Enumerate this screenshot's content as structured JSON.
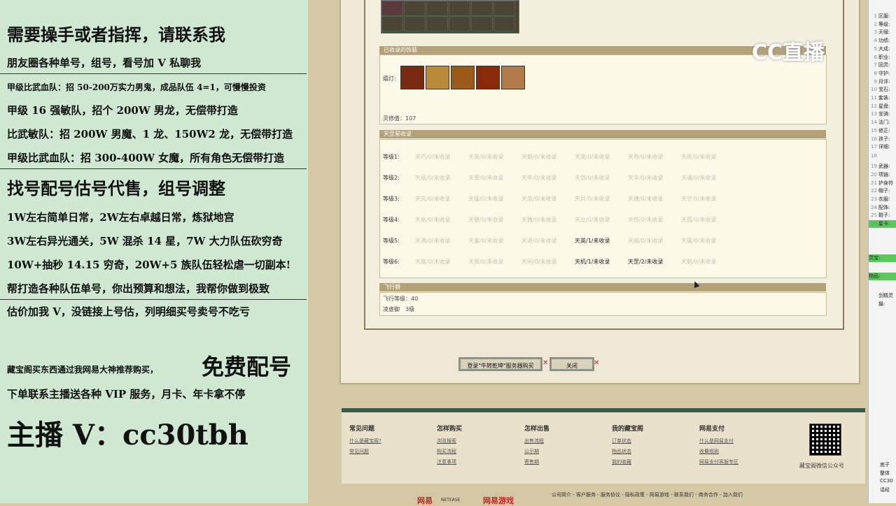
{
  "left": {
    "lines": [
      "需要操手或者指挥，请联系我",
      "朋友圈各种单号，组号，看号加 V 私聊我",
      "甲级比武血队：招 50-200万实力男鬼，成品队伍 4=1，可慢慢投资",
      "甲级 16 强敏队，招个 200W 男龙，无偿带打造",
      "比武敏队：招 200W 男魔、1 龙、150W2 龙，无偿带打造",
      "甲级比武血队：招 300-400W 女魔，所有角色无偿带打造",
      "找号配号估号代售，组号调整",
      "1W左右简单日常，2W左右卓越日常，炼狱地宫",
      "3W左右异光通关，5W 混杀 14 星，7W 大力队伍砍穷奇",
      "10W+抽秒 14.15 穷奇，20W+5 族队伍轻松虐一切副本!",
      "帮打造各种队伍单号，你出预算和想法，我帮你做到极致",
      "估价加我 V，没链接上号估，列明细买号卖号不吃亏",
      "藏宝阁买东西通过我网易大神推荐购买，",
      "免费配号",
      "下单联系主播送各种 VIP 服务，月卡、年卡拿不停",
      "主播 V：cc30tbh"
    ]
  },
  "game": {
    "collected_header": "已收录的饰装",
    "equip_label": "嬉灯:",
    "lingxiu": "灵修值：107",
    "tiangang_header": "天罡星收录",
    "levels": [
      "等级1:",
      "等级2:",
      "等级3:",
      "等级4:",
      "等级5:",
      "等级6:"
    ],
    "grid": [
      [
        "天巧/0/未收录",
        "天英/0/未收录",
        "天魁/0/未收录",
        "天哭/0/未收录",
        "天寿/0/未收录",
        "天败/0/未收录"
      ],
      [
        "天损/0/未收录",
        "天罪/0/未收录",
        "天牢/0/未收录",
        "天剑/0/未收录",
        "天华/0/未收录",
        "天速/0/未收录"
      ],
      [
        "天究/0/未收录",
        "天猛/0/未收录",
        "天杀/0/未收录",
        "天异/0/未收录",
        "天捷/0/未收录",
        "天空/0/未收录"
      ],
      [
        "天佑/0/未收录",
        "天暴/0/未收录",
        "天微/0/未收录",
        "天立/0/未收录",
        "天伤/0/未收录",
        "天孤/0/未收录"
      ],
      [
        "天满/0/未收录",
        "天富/0/未收录",
        "天退/0/未收录",
        "天英/1/未收录",
        "天威/0/未收录",
        "天猛/0/未收录"
      ],
      [
        "天雄/0/未收录",
        "天贵/0/未收录",
        "天闲/0/未收录",
        "天机/1/未收录",
        "天罡/2/未收录",
        "天魁/0/未收录"
      ]
    ],
    "grid_active": [
      [
        4,
        3
      ],
      [
        5,
        3
      ],
      [
        5,
        4
      ]
    ],
    "flight_header": "飞行器",
    "flight_level": "飞行等级：40",
    "flight_speed": "凌虚御　3级",
    "login_button": "登录\"牛转乾坤\"服务器购买",
    "close_button": "关闭",
    "watermark": "CC直播"
  },
  "footer": {
    "cols": [
      {
        "title": "常见问题",
        "links": [
          "什么是藏宝阁?",
          "常见问题"
        ]
      },
      {
        "title": "怎样购买",
        "links": [
          "浏览搜索",
          "购买流程",
          "注意事项"
        ]
      },
      {
        "title": "怎样出售",
        "links": [
          "出售流程",
          "公示期",
          "寄售期"
        ]
      },
      {
        "title": "我的藏宝阁",
        "links": [
          "订单状态",
          "物品状态",
          "我的收藏"
        ]
      },
      {
        "title": "网易支付",
        "links": [
          "什么是网易支付",
          "收費规则",
          "网易支付客服专区"
        ]
      }
    ],
    "qr_caption": "藏宝阁微信公众号",
    "bottom_links": "公司简介 - 客户服务 - 服务协议 - 隐私政策 - 网易游戏 - 联系我们 - 商务合作 - 加入我们",
    "logo_netease": "网易",
    "logo_netease_en": "NETEASE",
    "logo_games": "网易游戏"
  },
  "right_panel": {
    "rows": [
      {
        "n": "1",
        "t": "区服:"
      },
      {
        "n": "2",
        "t": "等级:"
      },
      {
        "n": "3",
        "t": "天赋:"
      },
      {
        "n": "4",
        "t": "功绩:"
      },
      {
        "n": "5",
        "t": "大成:"
      },
      {
        "n": "6",
        "t": "职业:"
      },
      {
        "n": "7",
        "t": "回灵:"
      },
      {
        "n": "8",
        "t": "守护:"
      },
      {
        "n": "9",
        "t": "月评:"
      },
      {
        "n": "10",
        "t": "宝石:"
      },
      {
        "n": "11",
        "t": "套装:"
      },
      {
        "n": "12",
        "t": "星盘:"
      },
      {
        "n": "13",
        "t": "坐骑:"
      },
      {
        "n": "14",
        "t": "法门:"
      },
      {
        "n": "15",
        "t": "修正:"
      },
      {
        "n": "16",
        "t": "孩子:"
      },
      {
        "n": "17",
        "t": "详细:"
      },
      {
        "n": "18",
        "t": ""
      },
      {
        "n": "19",
        "t": "武器:"
      },
      {
        "n": "20",
        "t": "项链:"
      },
      {
        "n": "21",
        "t": "护身符"
      },
      {
        "n": "22",
        "t": "帽子:"
      },
      {
        "n": "23",
        "t": "衣服:"
      },
      {
        "n": "24",
        "t": "配饰:"
      },
      {
        "n": "25",
        "t": "鞋子:"
      },
      {
        "n": "26",
        "t": "星卡:"
      }
    ],
    "green_rows": [
      "星卡:",
      "灵宝:",
      "物品:"
    ],
    "extra": [
      "剑精灵",
      "猫:"
    ],
    "bottom": [
      "底子",
      "整体",
      "CC30",
      "话经"
    ]
  }
}
